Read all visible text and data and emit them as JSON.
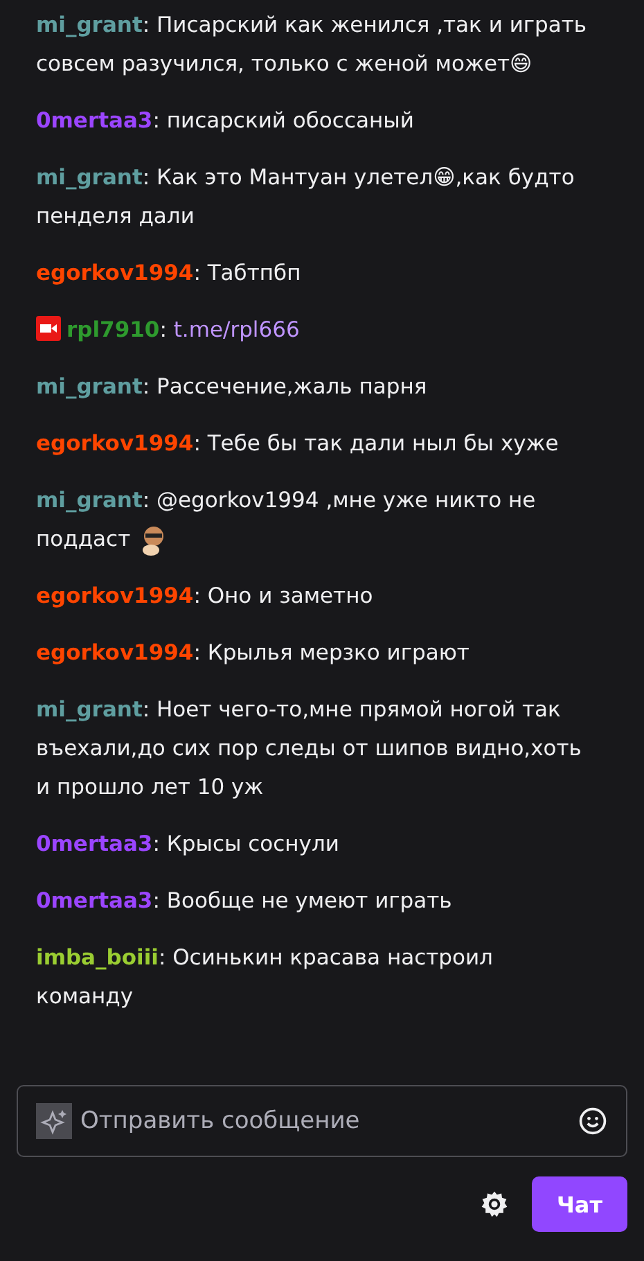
{
  "messages": [
    {
      "user": "mi_grant",
      "color": "#5f9ea0",
      "parts": [
        {
          "kind": "text",
          "text": ": Писарский как женился ,так и играть совсем разучился, только с женой может😄"
        }
      ]
    },
    {
      "user": "0mertaa3",
      "color": "#9b45ff",
      "parts": [
        {
          "kind": "text",
          "text": ": писарский обоссаный"
        }
      ]
    },
    {
      "user": "mi_grant",
      "color": "#5f9ea0",
      "parts": [
        {
          "kind": "text",
          "text": ": Как это Мантуан улетел😁,как будто пенделя дали"
        }
      ]
    },
    {
      "user": "egorkov1994",
      "color": "#ff4500",
      "parts": [
        {
          "kind": "text",
          "text": ": Табтпбп"
        }
      ]
    },
    {
      "user": "rpl7910",
      "color": "#2e9a2e",
      "parts": [
        {
          "kind": "badge"
        },
        {
          "kind": "text",
          "text": ": "
        },
        {
          "kind": "link",
          "text": "t.me/rpl666"
        }
      ]
    },
    {
      "user": "mi_grant",
      "color": "#5f9ea0",
      "parts": [
        {
          "kind": "text",
          "text": ": Рассечение,жаль парня"
        }
      ]
    },
    {
      "user": "egorkov1994",
      "color": "#ff4500",
      "parts": [
        {
          "kind": "text",
          "text": ": Тебе бы так дали ныл бы хуже"
        }
      ]
    },
    {
      "user": "mi_grant",
      "color": "#5f9ea0",
      "parts": [
        {
          "kind": "text",
          "text": ": @egorkov1994  ,мне уже никто не поддаст "
        },
        {
          "kind": "emote"
        }
      ]
    },
    {
      "user": "egorkov1994",
      "color": "#ff4500",
      "parts": [
        {
          "kind": "text",
          "text": ": Оно и заметно"
        }
      ]
    },
    {
      "user": "egorkov1994",
      "color": "#ff4500",
      "parts": [
        {
          "kind": "text",
          "text": ": Крылья мерзко играют"
        }
      ]
    },
    {
      "user": "mi_grant",
      "color": "#5f9ea0",
      "parts": [
        {
          "kind": "text",
          "text": ": Ноет чего-то,мне прямой ногой так въехали,до сих пор следы от шипов видно,хоть и прошло лет 10 уж"
        }
      ]
    },
    {
      "user": "0mertaa3",
      "color": "#9b45ff",
      "parts": [
        {
          "kind": "text",
          "text": ": Крысы соснули"
        }
      ]
    },
    {
      "user": "0mertaa3",
      "color": "#9b45ff",
      "parts": [
        {
          "kind": "text",
          "text": ": Вообще не умеют играть"
        }
      ]
    },
    {
      "user": "imba_boiii",
      "color": "#9acd32",
      "parts": [
        {
          "kind": "text",
          "text": ": Осинькин красава настроил команду"
        }
      ]
    }
  ],
  "input": {
    "placeholder": "Отправить сообщение"
  },
  "chat_button": "Чат"
}
